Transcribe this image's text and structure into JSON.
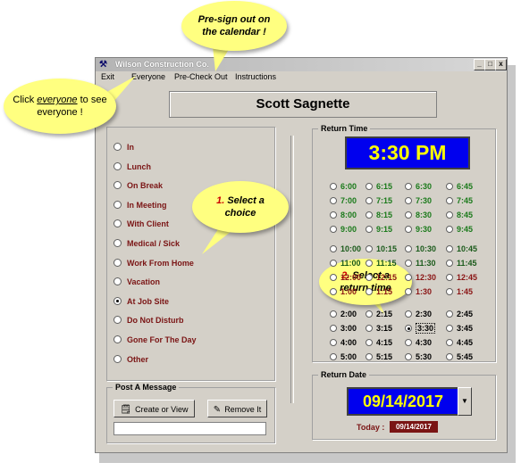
{
  "window": {
    "title": "Wilson Construction Co.",
    "controls": {
      "min": "_",
      "max": "□",
      "close": "x"
    }
  },
  "menu": [
    "Exit",
    "Everyone",
    "Pre-Check Out",
    "Instructions"
  ],
  "employee_name": "Scott Sagnette",
  "status": {
    "options": [
      "In",
      "Lunch",
      "On Break",
      "In Meeting",
      "With Client",
      "Medical / Sick",
      "Work From Home",
      "Vacation",
      "At Job Site",
      "Do Not Disturb",
      "Gone For The Day",
      "Other"
    ],
    "selected": "At Job Site"
  },
  "return_time": {
    "legend": "Return Time",
    "display": "3:30 PM",
    "slots": [
      [
        "6:00",
        "6:15",
        "6:30",
        "6:45"
      ],
      [
        "7:00",
        "7:15",
        "7:30",
        "7:45"
      ],
      [
        "8:00",
        "8:15",
        "8:30",
        "8:45"
      ],
      [
        "9:00",
        "9:15",
        "9:30",
        "9:45"
      ],
      [
        "10:00",
        "10:15",
        "10:30",
        "10:45"
      ],
      [
        "11:00",
        "11:15",
        "11:30",
        "11:45"
      ],
      [
        "12:00",
        "12:15",
        "12:30",
        "12:45"
      ],
      [
        "1:00",
        "1:15",
        "1:30",
        "1:45"
      ],
      [
        "2:00",
        "2:15",
        "2:30",
        "2:45"
      ],
      [
        "3:00",
        "3:15",
        "3:30",
        "3:45"
      ],
      [
        "4:00",
        "4:15",
        "4:30",
        "4:45"
      ],
      [
        "5:00",
        "5:15",
        "5:30",
        "5:45"
      ]
    ],
    "selected": "3:30"
  },
  "return_date": {
    "legend": "Return Date",
    "display": "09/14/2017",
    "today_label": "Today :",
    "today_value": "09/14/2017"
  },
  "message": {
    "legend": "Post A Message",
    "create_label": "Create or View",
    "remove_label": "Remove It",
    "input_value": ""
  },
  "callouts": {
    "presign": "Pre-sign out on the calendar !",
    "everyone_pre": "Click",
    "everyone_word": "everyone",
    "everyone_post": "to see everyone !",
    "choice_num": "1.",
    "choice_text": "Select a choice",
    "return_num": "2.",
    "return_text": "Select a return time"
  },
  "colors": {
    "display_bg": "#0000ee",
    "display_fg": "#ffff00",
    "status_text": "#7a1414",
    "time_green": "#1a7a1a",
    "time_red": "#8a1414",
    "bubble": "#ffff80"
  }
}
